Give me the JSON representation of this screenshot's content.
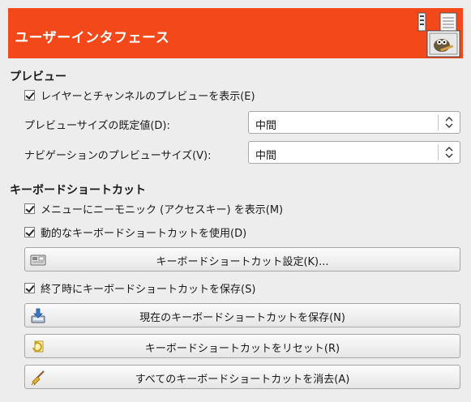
{
  "header": {
    "title": "ユーザーインタフェース",
    "icon": "wilber-preferences-icon"
  },
  "preview": {
    "title": "プレビュー",
    "layer_channel_preview": {
      "label": "レイヤーとチャンネルのプレビューを表示(E)",
      "checked": true
    },
    "default_size": {
      "label": "プレビューサイズの既定値(D):",
      "value": "中間"
    },
    "navigation_size": {
      "label": "ナビゲーションのプレビューサイズ(V):",
      "value": "中間"
    }
  },
  "shortcuts": {
    "title": "キーボードショートカット",
    "show_mnemonics": {
      "label": "メニューにニーモニック (アクセスキー) を表示(M)",
      "checked": true
    },
    "dynamic_shortcuts": {
      "label": "動的なキーボードショートカットを使用(D)",
      "checked": true
    },
    "configure_button": {
      "label": "キーボードショートカット設定(K)...",
      "icon": "keyboard-icon"
    },
    "save_on_exit": {
      "label": "終了時にキーボードショートカットを保存(S)",
      "checked": true
    },
    "save_button": {
      "label": "現在のキーボードショートカットを保存(N)",
      "icon": "save-icon"
    },
    "reset_button": {
      "label": "キーボードショートカットをリセット(R)",
      "icon": "reset-icon"
    },
    "clear_button": {
      "label": "すべてのキーボードショートカットを消去(A)",
      "icon": "broom-icon"
    }
  },
  "colors": {
    "header_bg": "#f2481a",
    "window_bg": "#ededed"
  }
}
